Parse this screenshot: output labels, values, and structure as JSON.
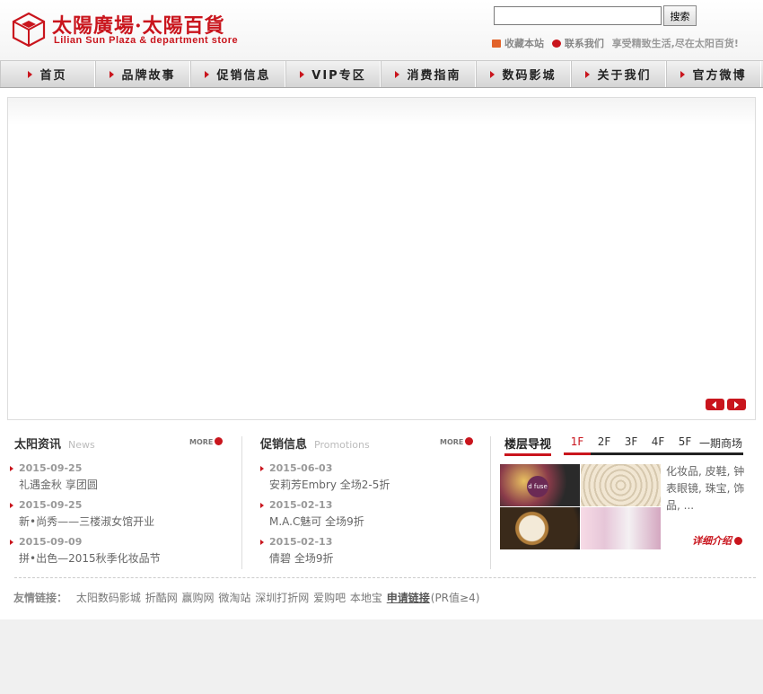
{
  "header": {
    "logo_cn": "太陽廣場·太陽百貨",
    "logo_en": "Lilian Sun Plaza & department store",
    "search_placeholder": "",
    "search_button": "搜索",
    "fav_link": "收藏本站",
    "contact_link": "联系我们",
    "slogan": "享受精致生活,尽在太阳百货!"
  },
  "nav": {
    "items": [
      "首页",
      "品牌故事",
      "促销信息",
      "VIP专区",
      "消费指南",
      "数码影城",
      "关于我们",
      "官方微博"
    ]
  },
  "news": {
    "title": "太阳资讯",
    "subtitle": "News",
    "more": "MORE",
    "items": [
      {
        "date": "2015-09-25",
        "title": "礼遇金秋 享团圆"
      },
      {
        "date": "2015-09-25",
        "title": "新•尚秀——三楼淑女馆开业"
      },
      {
        "date": "2015-09-09",
        "title": "拼•出色—2015秋季化妆品节"
      }
    ]
  },
  "promotions": {
    "title": "促销信息",
    "subtitle": "Promotions",
    "more": "MORE",
    "items": [
      {
        "date": "2015-06-03",
        "title": "安莉芳Embry 全场2-5折"
      },
      {
        "date": "2015-02-13",
        "title": "M.A.C魅可 全场9折"
      },
      {
        "date": "2015-02-13",
        "title": "倩碧 全场9折"
      }
    ]
  },
  "floor": {
    "title": "楼层导视",
    "tabs": [
      "1F",
      "2F",
      "3F",
      "4F",
      "5F",
      "一期商场"
    ],
    "active_tab": "1F",
    "description": "化妆品, 皮鞋, 钟表眼镜, 珠宝, 饰品, ...",
    "img_logo_text": "d fuse",
    "detail_link": "详细介绍"
  },
  "friend_links": {
    "label": "友情链接：",
    "links": [
      "太阳数码影城",
      "折酷网",
      "赢购网",
      "微淘站",
      "深圳打折网",
      "爱购吧",
      "本地宝"
    ],
    "apply": "申请链接",
    "apply_note": "(PR值≥4)"
  },
  "colors": {
    "accent": "#c9151d"
  }
}
